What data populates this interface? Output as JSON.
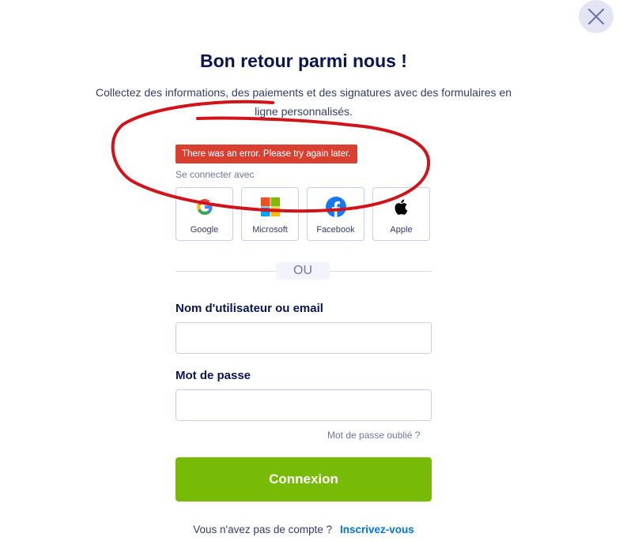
{
  "header": {
    "title": "Bon retour parmi nous !",
    "subtitle": "Collectez des informations, des paiements et des signatures avec des formulaires en ligne personnalisés."
  },
  "error": {
    "message": "There was an error. Please try again later."
  },
  "social": {
    "heading": "Se connecter avec",
    "providers": [
      {
        "label": "Google",
        "icon": "google-icon"
      },
      {
        "label": "Microsoft",
        "icon": "microsoft-icon"
      },
      {
        "label": "Facebook",
        "icon": "facebook-icon"
      },
      {
        "label": "Apple",
        "icon": "apple-icon"
      }
    ]
  },
  "divider": {
    "text": "OU"
  },
  "form": {
    "username_label": "Nom d'utilisateur ou email",
    "username_value": "",
    "password_label": "Mot de passe",
    "password_value": "",
    "forgot_label": "Mot de passe oublié ?",
    "submit_label": "Connexion"
  },
  "footer": {
    "no_account_text": "Vous n'avez pas de compte ?",
    "signup_label": "Inscrivez-vous"
  },
  "colors": {
    "primary_navy": "#0a1551",
    "submit_green": "#78bb07",
    "error_red": "#d94030",
    "link_blue": "#0075e3",
    "annotation_red": "#d0141a"
  }
}
